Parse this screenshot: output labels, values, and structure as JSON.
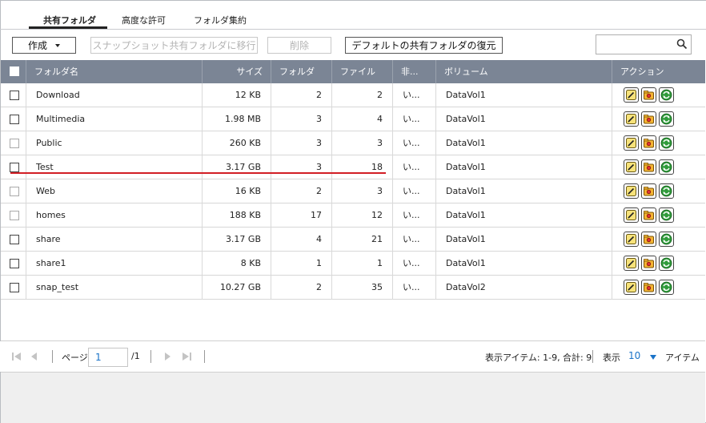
{
  "tabs": [
    {
      "label": "共有フォルダ",
      "active": true
    },
    {
      "label": "高度な許可",
      "active": false
    },
    {
      "label": "フォルダ集約",
      "active": false
    }
  ],
  "toolbar": {
    "create_label": "作成",
    "snapshot_label": "スナップショット共有フォルダに移行",
    "delete_label": "削除",
    "restore_label": "デフォルトの共有フォルダの復元",
    "search_placeholder": ""
  },
  "columns": {
    "name": "フォルダ名",
    "size": "サイズ",
    "folders": "フォルダ",
    "files": "ファイル",
    "hidden": "非...",
    "volume": "ボリューム",
    "action": "アクション"
  },
  "rows": [
    {
      "name": "Download",
      "size": "12 KB",
      "folders": "2",
      "files": "2",
      "hidden": "い...",
      "volume": "DataVol1",
      "checkbox_dim": false
    },
    {
      "name": "Multimedia",
      "size": "1.98 MB",
      "folders": "3",
      "files": "4",
      "hidden": "い...",
      "volume": "DataVol1",
      "checkbox_dim": false
    },
    {
      "name": "Public",
      "size": "260 KB",
      "folders": "3",
      "files": "3",
      "hidden": "い...",
      "volume": "DataVol1",
      "checkbox_dim": true
    },
    {
      "name": "Test",
      "size": "3.17 GB",
      "folders": "3",
      "files": "18",
      "hidden": "い...",
      "volume": "DataVol1",
      "checkbox_dim": false
    },
    {
      "name": "Web",
      "size": "16 KB",
      "folders": "2",
      "files": "3",
      "hidden": "い...",
      "volume": "DataVol1",
      "checkbox_dim": true
    },
    {
      "name": "homes",
      "size": "188 KB",
      "folders": "17",
      "files": "12",
      "hidden": "い...",
      "volume": "DataVol1",
      "checkbox_dim": true
    },
    {
      "name": "share",
      "size": "3.17 GB",
      "folders": "4",
      "files": "21",
      "hidden": "い...",
      "volume": "DataVol1",
      "checkbox_dim": false
    },
    {
      "name": "share1",
      "size": "8 KB",
      "folders": "1",
      "files": "1",
      "hidden": "い...",
      "volume": "DataVol1",
      "checkbox_dim": false
    },
    {
      "name": "snap_test",
      "size": "10.27 GB",
      "folders": "2",
      "files": "35",
      "hidden": "い...",
      "volume": "DataVol2",
      "checkbox_dim": false
    }
  ],
  "pagination": {
    "page_label": "ページ",
    "page_value": "1",
    "total_pages": "/1",
    "items_label": "表示アイテム: 1-9, 合計: 9",
    "show_label": "表示",
    "per_page": "10",
    "items_suffix": "アイテム"
  },
  "colors": {
    "header_bg": "#7b8595",
    "accent_blue": "#1a73c8",
    "highlight_red": "#d21f25"
  },
  "icons": {
    "search": "search-icon",
    "edit": "edit-properties-icon",
    "permission": "folder-permission-icon",
    "refresh": "refresh-icon"
  }
}
